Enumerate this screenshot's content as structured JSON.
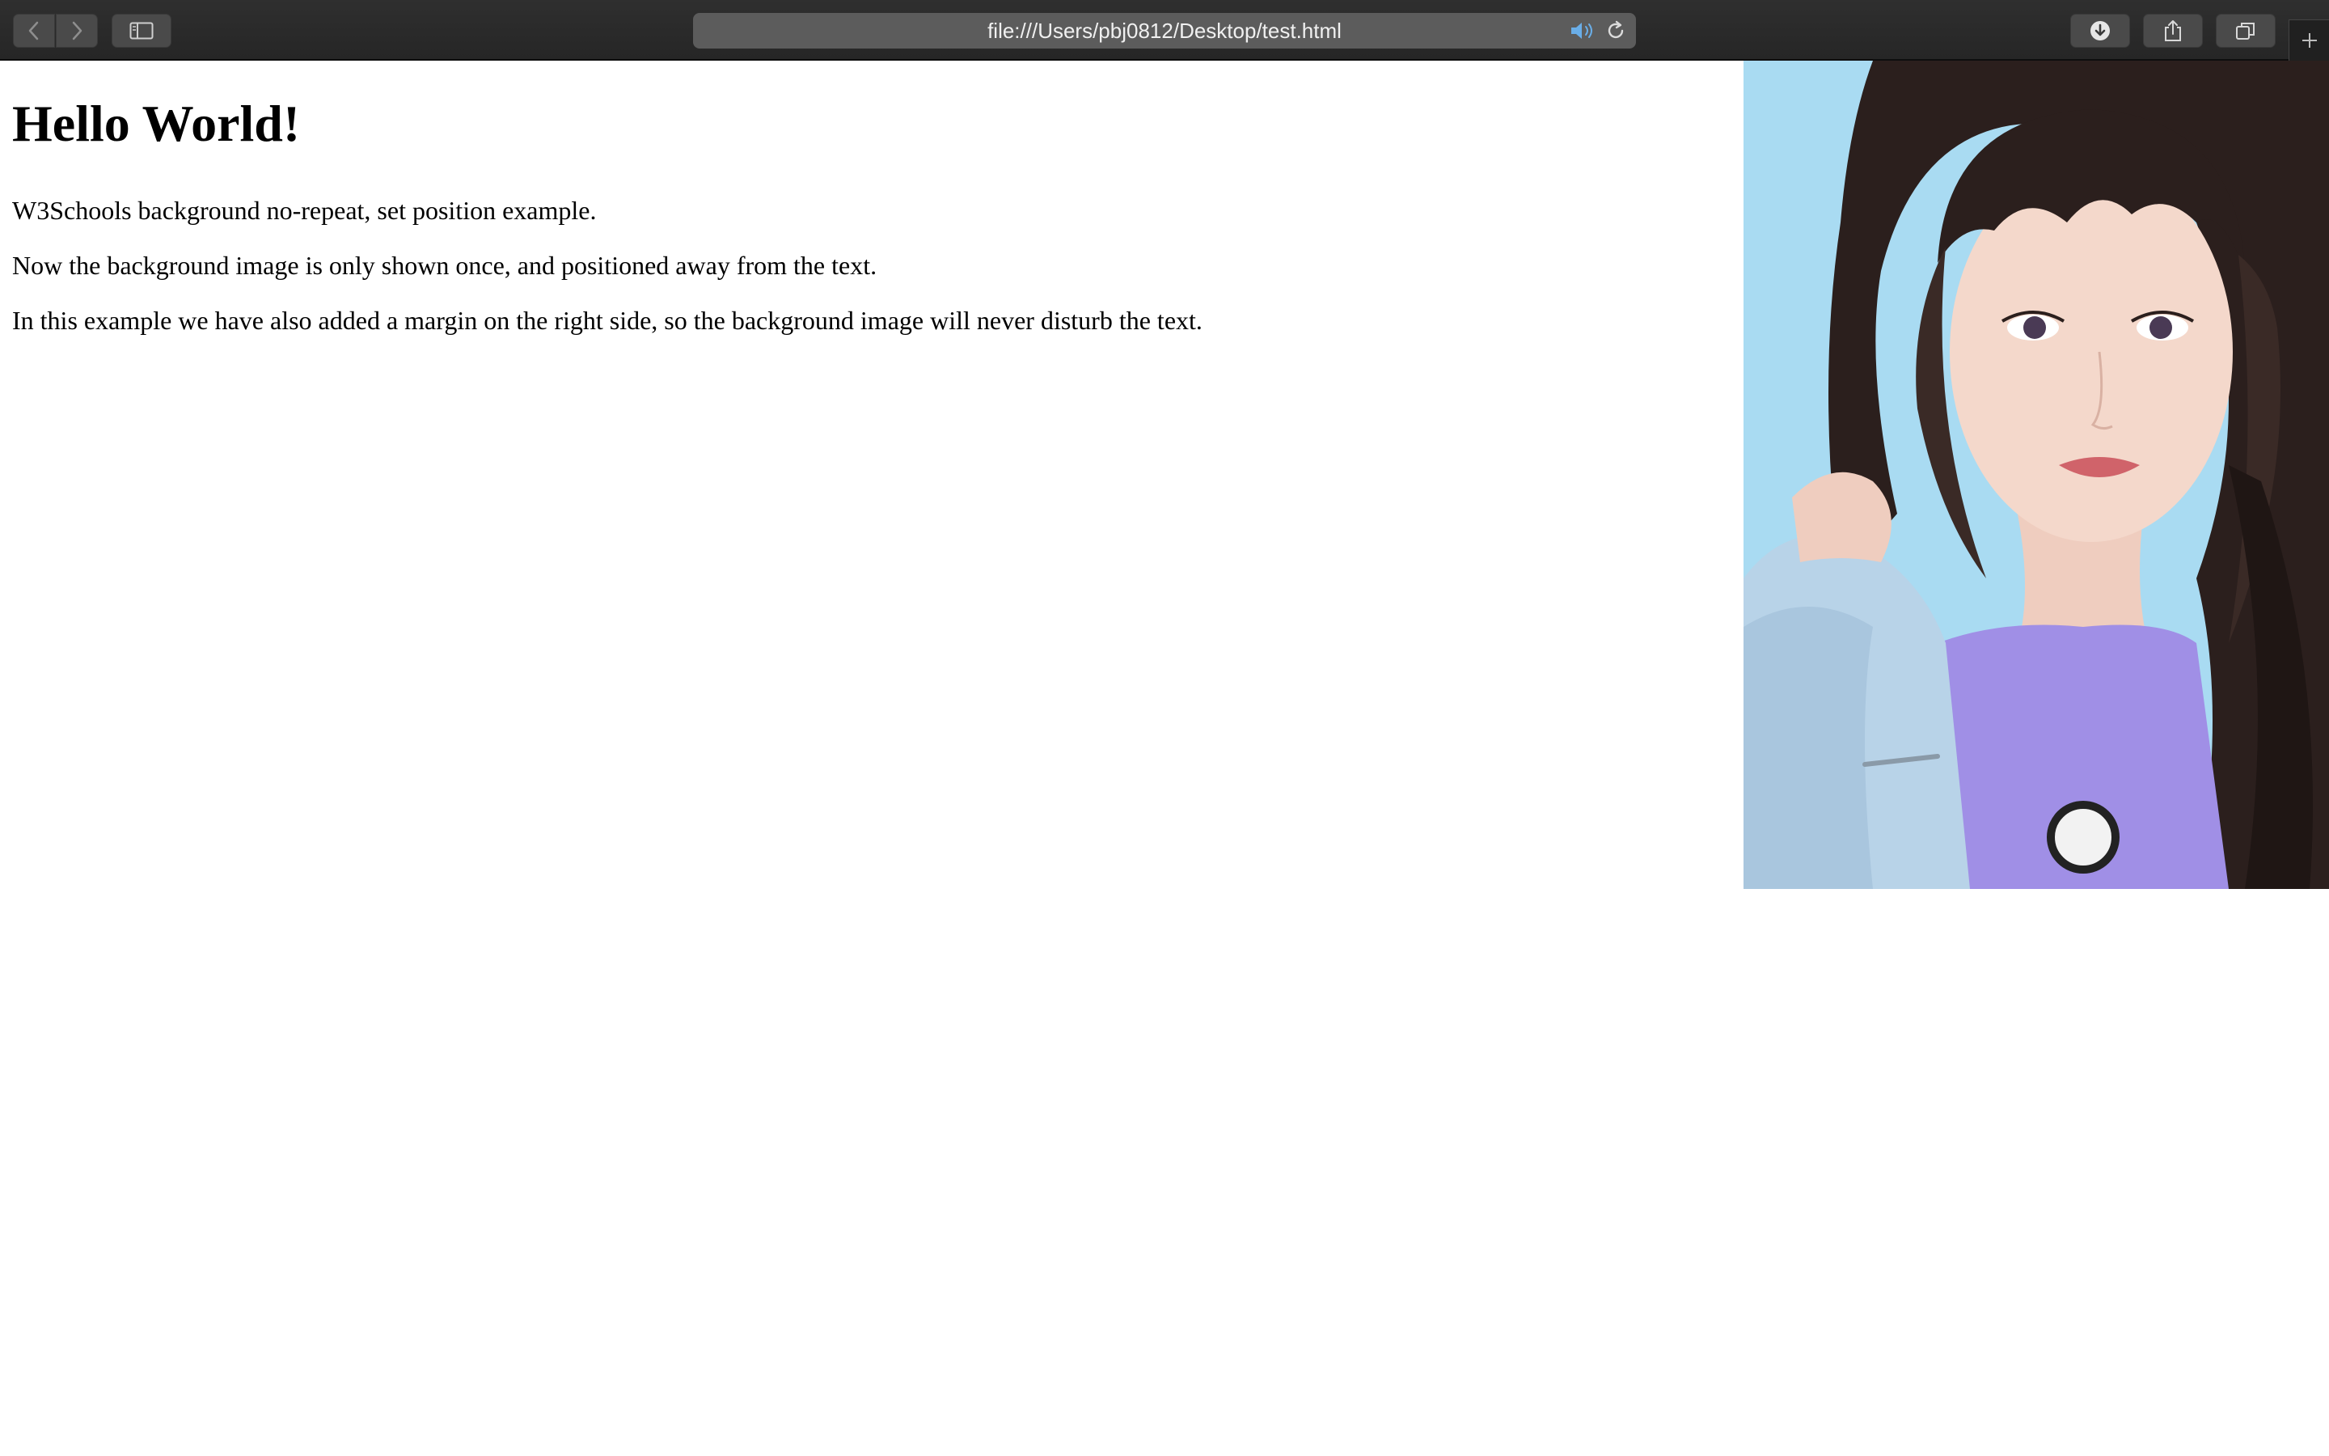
{
  "browser": {
    "address": "file:///Users/pbj0812/Desktop/test.html",
    "icons": {
      "back": "chevron-left-icon",
      "forward": "chevron-right-icon",
      "sidebar": "sidebar-icon",
      "speaker": "speaker-icon",
      "reload": "reload-icon",
      "download": "download-icon",
      "share": "share-icon",
      "tabs": "tab-overview-icon",
      "new_tab": "plus-icon"
    },
    "accent_color": "#6aaee8"
  },
  "page": {
    "heading": "Hello World!",
    "paragraphs": [
      "W3Schools background no-repeat, set position example.",
      "Now the background image is only shown once, and positioned away from the text.",
      "In this example we have also added a margin on the right side, so the background image will never disturb the text."
    ],
    "image": {
      "subject": "portrait",
      "colors": {
        "sky": "#a9dbf2",
        "hair": "#2b1f1d",
        "skin": "#f4d8cb",
        "denim": "#b8d3e8",
        "shirt": "#a08fe6"
      }
    }
  }
}
